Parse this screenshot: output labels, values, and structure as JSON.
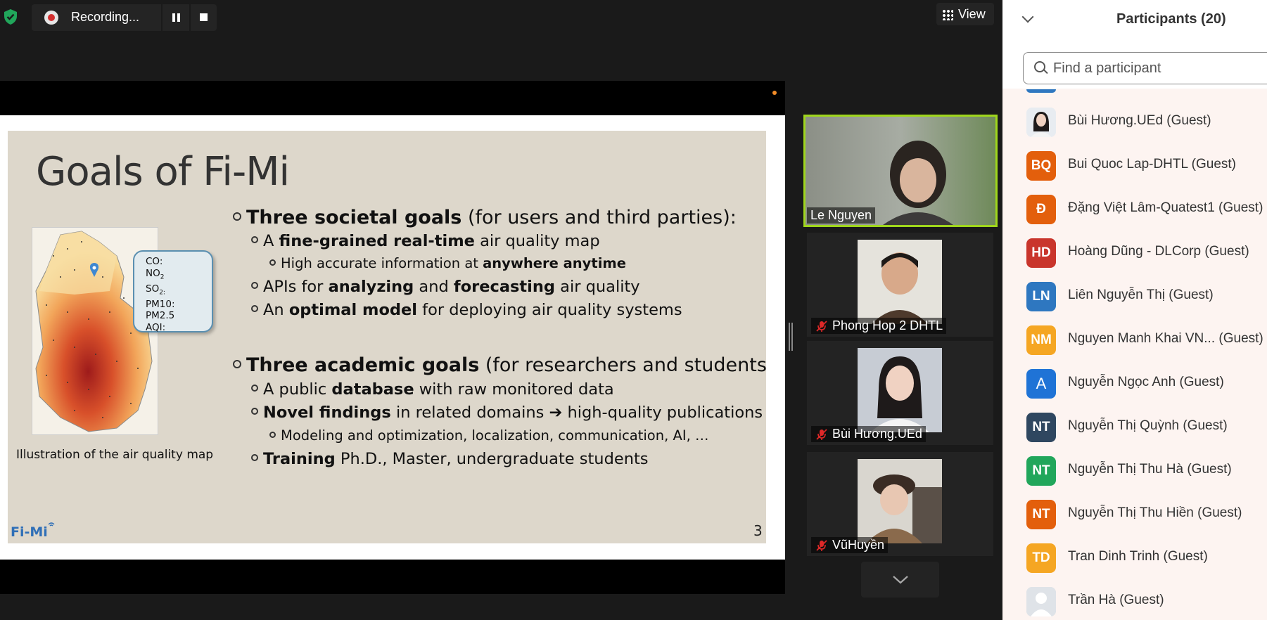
{
  "toolbar": {
    "recording_label": "Recording...",
    "view_label": "View"
  },
  "slide": {
    "title": "Goals of Fi-Mi",
    "map_caption": "Illustration of the air quality map",
    "callout_items": [
      "CO:",
      "NO",
      "SO",
      "PM10:",
      "PM2.5",
      "AQI:"
    ],
    "callout_subscripts": [
      "2",
      "2:"
    ],
    "bullets": [
      {
        "bold": "Three societal goals",
        "rest": " (for users and third parties):"
      },
      {
        "pre": "A ",
        "bold": "fine-grained real-time",
        "rest": " air quality map"
      },
      {
        "pre": "High accurate information at ",
        "bold": "anywhere anytime",
        "rest": ""
      },
      {
        "pre": "APIs for ",
        "bold": "analyzing",
        "mid": " and ",
        "bold2": "forecasting",
        "rest": " air quality"
      },
      {
        "pre": "An ",
        "bold": "optimal model",
        "rest": " for deploying air quality systems"
      },
      {
        "bold": "Three academic goals",
        "rest": " (for researchers and students):"
      },
      {
        "pre": "A public ",
        "bold": "database",
        "rest": " with raw monitored data"
      },
      {
        "bold": "Novel findings",
        "rest": " in related domains ➔ high-quality publications"
      },
      {
        "pre": "Modeling and optimization, localization, communication, AI, …"
      },
      {
        "bold": "Training",
        "rest": " Ph.D., Master, undergraduate students"
      }
    ],
    "logo_text": "Fi-Mi",
    "page_number": "3"
  },
  "video_tiles": [
    {
      "name": "Le Nguyen",
      "muted": false,
      "active": true
    },
    {
      "name": "Phong Hop 2 DHTL",
      "muted": true
    },
    {
      "name": "Bùi Hương.UEd",
      "muted": true
    },
    {
      "name": "VũHuyền",
      "muted": true
    }
  ],
  "participants_panel": {
    "title": "Participants (20)",
    "search_placeholder": "Find a participant",
    "participants": [
      {
        "initials": "",
        "name": "Bùi Hương.UEd (Guest)",
        "color": "#dfe6ee",
        "photo": true
      },
      {
        "initials": "BQ",
        "name": "Bui Quoc Lap-DHTL (Guest)",
        "color": "#e35f0c"
      },
      {
        "initials": "Đ",
        "name": "Đặng Việt Lâm-Quatest1 (Guest)",
        "color": "#e35f0c"
      },
      {
        "initials": "HD",
        "name": "Hoàng Dũng - DLCorp (Guest)",
        "color": "#c9352c"
      },
      {
        "initials": "LN",
        "name": "Liên Nguyễn Thị (Guest)",
        "color": "#2e77c0"
      },
      {
        "initials": "NM",
        "name": "Nguyen Manh Khai VN...  (Guest)",
        "color": "#f5a623"
      },
      {
        "initials": "A",
        "name": "Nguyễn Ngọc Anh (Guest)",
        "color": "#1f73d6"
      },
      {
        "initials": "NT",
        "name": "Nguyễn Thị Quỳnh (Guest)",
        "color": "#2f4760"
      },
      {
        "initials": "NT",
        "name": "Nguyễn Thị Thu Hà (Guest)",
        "color": "#21a65b"
      },
      {
        "initials": "NT",
        "name": "Nguyễn Thị Thu Hiền (Guest)",
        "color": "#e35f0c"
      },
      {
        "initials": "TD",
        "name": "Tran Dinh Trinh (Guest)",
        "color": "#f5a623"
      },
      {
        "initials": "",
        "name": "Trần Hà (Guest)",
        "color": "#d7dce2",
        "placeholder": true
      }
    ]
  },
  "colors": {
    "active_speaker_border": "#9fd61c",
    "recording_dot": "#d32f2f",
    "secure_shield": "#21a65b"
  },
  "icons": [
    "shield-check-icon",
    "record-icon",
    "pause-icon",
    "stop-icon",
    "grid-view-icon",
    "chevron-down-icon",
    "search-icon",
    "mic-muted-icon"
  ]
}
